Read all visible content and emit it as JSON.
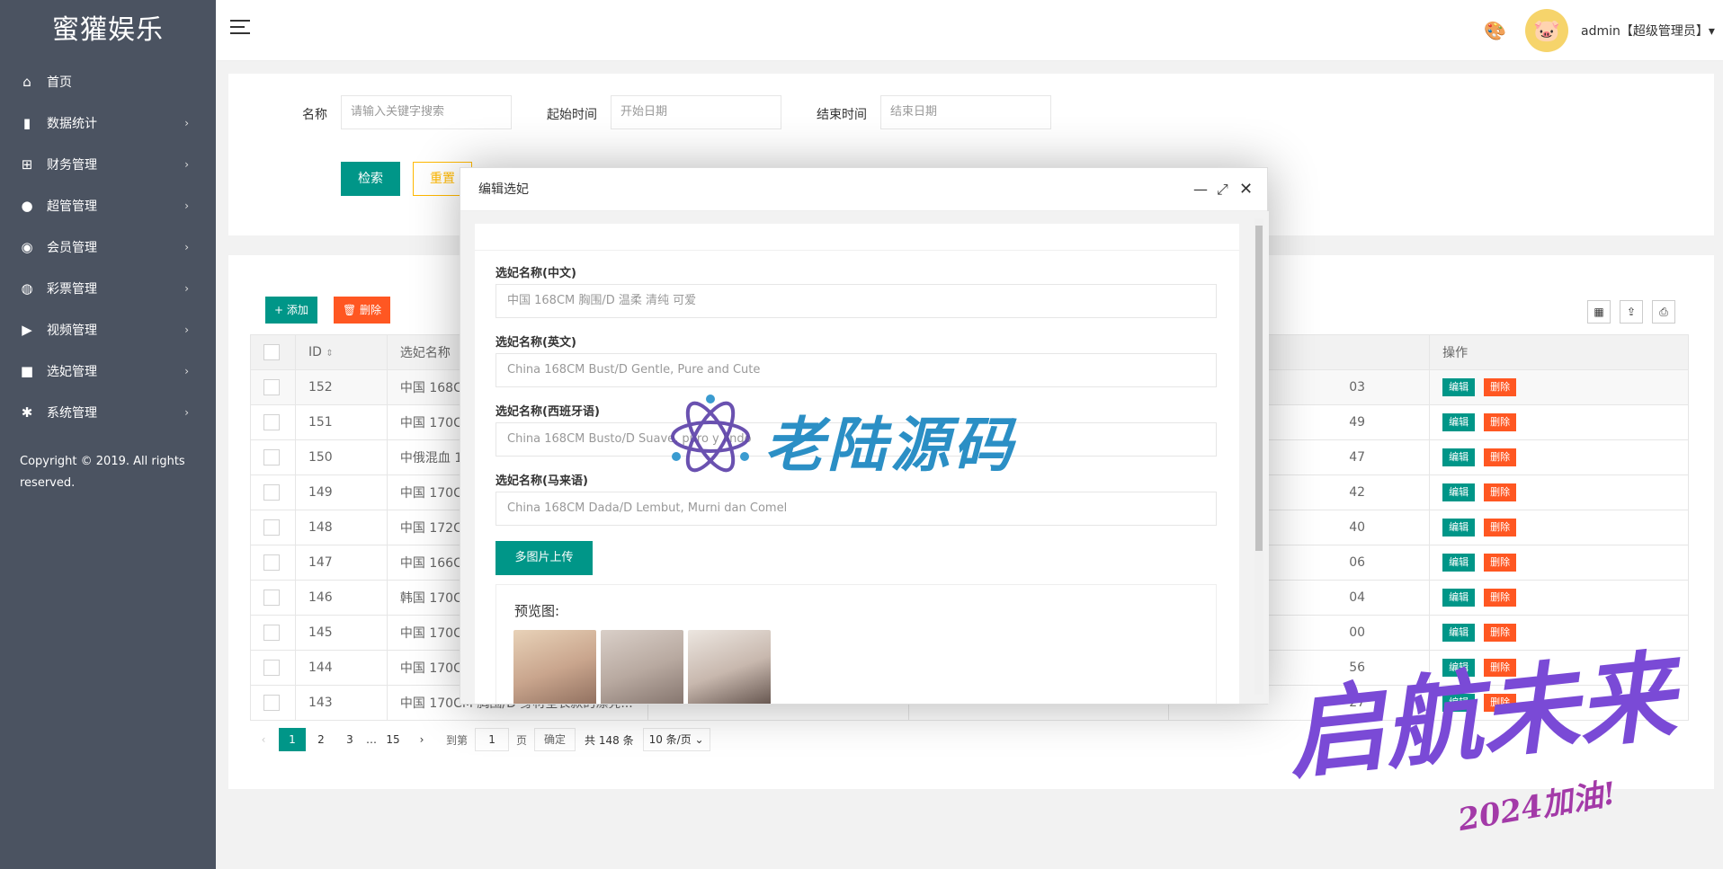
{
  "brand": "蜜獾娱乐",
  "sidebar": {
    "items": [
      {
        "label": "首页",
        "icon": "home-icon",
        "glyph": "⌂",
        "has_children": false
      },
      {
        "label": "数据统计",
        "icon": "bar-chart-icon",
        "glyph": "▮",
        "has_children": true
      },
      {
        "label": "财务管理",
        "icon": "bank-icon",
        "glyph": "⊞",
        "has_children": true
      },
      {
        "label": "超管管理",
        "icon": "user-icon",
        "glyph": "●",
        "has_children": true
      },
      {
        "label": "会员管理",
        "icon": "users-icon",
        "glyph": "◉",
        "has_children": true
      },
      {
        "label": "彩票管理",
        "icon": "gamepad-icon",
        "glyph": "◍",
        "has_children": true
      },
      {
        "label": "视频管理",
        "icon": "video-icon",
        "glyph": "▶",
        "has_children": true
      },
      {
        "label": "选妃管理",
        "icon": "camera-icon",
        "glyph": "■",
        "has_children": true
      },
      {
        "label": "系统管理",
        "icon": "gear-icon",
        "glyph": "✱",
        "has_children": true
      }
    ],
    "chevron": "›",
    "copyright": "Copyright © 2019. All rights reserved."
  },
  "header": {
    "user": "admin【超级管理员】▾"
  },
  "search": {
    "name_label": "名称",
    "name_placeholder": "请输入关键字搜索",
    "start_label": "起始时间",
    "start_placeholder": "开始日期",
    "end_label": "结束时间",
    "end_placeholder": "结束日期",
    "search_btn": "检索",
    "reset_btn": "重置"
  },
  "toolbar": {
    "add": "+ 添加",
    "delete": "🗑 删除"
  },
  "table": {
    "columns": [
      "ID",
      "选妃名称",
      "操作"
    ],
    "rows": [
      {
        "id": "152",
        "name": "中国 168C",
        "time": "03"
      },
      {
        "id": "151",
        "name": "中国 170C",
        "time": "49"
      },
      {
        "id": "150",
        "name": "中俄混血 1",
        "time": "47"
      },
      {
        "id": "149",
        "name": "中国 170C",
        "time": "42"
      },
      {
        "id": "148",
        "name": "中国 172C",
        "time": "40"
      },
      {
        "id": "147",
        "name": "中国 166C",
        "time": "06"
      },
      {
        "id": "146",
        "name": "韩国 170C",
        "time": "04"
      },
      {
        "id": "145",
        "name": "中国 170C",
        "time": "00"
      },
      {
        "id": "144",
        "name": "中国 170C",
        "time": "56"
      },
      {
        "id": "143",
        "name": "中国 170CM 胸围/D 身材全长款的漂亮...",
        "time": "27"
      }
    ],
    "edit_label": "编辑",
    "delete_label": "删除"
  },
  "pager": {
    "prev": "‹",
    "pages": [
      "1",
      "2",
      "3"
    ],
    "ellipsis": "…",
    "last": "15",
    "next": "›",
    "goto_label": "到第",
    "goto_value": "1",
    "page_unit": "页",
    "confirm": "确定",
    "total": "共 148 条",
    "per_page": "10 条/页 ⌄"
  },
  "modal": {
    "title": "编辑选妃",
    "fields": [
      {
        "label": "选妃名称(中文)",
        "value": "中国   168CM  胸围/D   温柔  清纯  可爱"
      },
      {
        "label": "选妃名称(英文)",
        "value": "China 168CM Bust/D Gentle, Pure and Cute"
      },
      {
        "label": "选妃名称(西班牙语)",
        "value": "China 168CM Busto/D Suave, puro y lindo"
      },
      {
        "label": "选妃名称(马来语)",
        "value": "China 168CM Dada/D Lembut, Murni dan Comel"
      }
    ],
    "upload_btn": "多图片上传",
    "preview_label": "预览图:"
  },
  "watermarks": {
    "center": "老陆源码",
    "corner_big": "启航未来",
    "corner_small": "2024加油!"
  },
  "colors": {
    "primary": "#009688",
    "danger": "#FF5722",
    "warn": "#FFB800",
    "sidebar": "#4b5361"
  }
}
